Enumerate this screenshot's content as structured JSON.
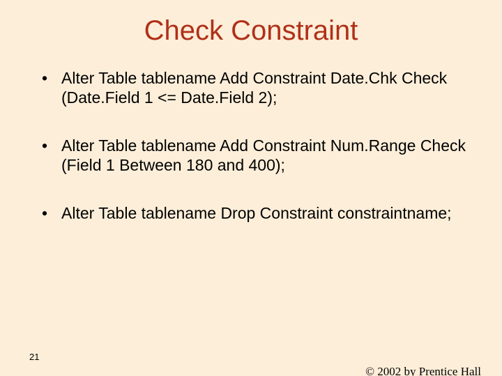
{
  "title": "Check Constraint",
  "bullets": [
    "Alter Table tablename Add Constraint Date.Chk Check (Date.Field 1 <= Date.Field 2);",
    "Alter Table tablename Add Constraint Num.Range Check (Field 1 Between 180 and 400);",
    "Alter Table tablename Drop Constraint constraintname;"
  ],
  "page_number": "21",
  "footer": "© 2002 by Prentice Hall"
}
